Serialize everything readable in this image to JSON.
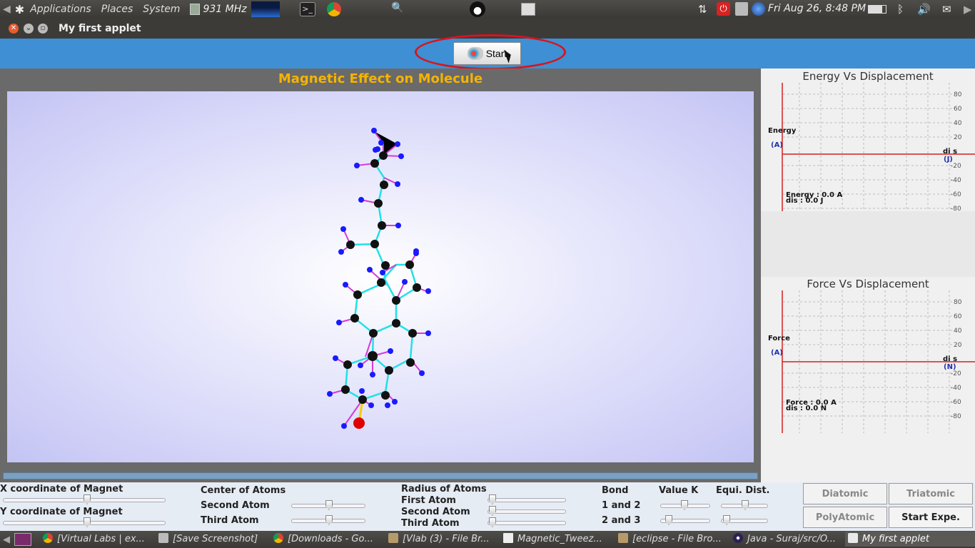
{
  "top_panel": {
    "menus": [
      "Applications",
      "Places",
      "System"
    ],
    "cpu_freq": "931 MHz",
    "clock": "Fri Aug 26,  8:48 PM"
  },
  "window": {
    "title": "My first applet"
  },
  "toolbar": {
    "start_label": "Start"
  },
  "sim": {
    "title": "Magnetic Effect on Molecule"
  },
  "graphs": {
    "energy": {
      "title": "Energy Vs Displacement",
      "y_label": "Energy",
      "y_unit": "(A)",
      "x_label": "di s",
      "x_unit": "(J)",
      "readout_1": "Energy : 0.0 A",
      "readout_2": "dis : 0.0 J",
      "ticks": [
        "80",
        "60",
        "40",
        "20",
        "-20",
        "-40",
        "-60",
        "-80"
      ]
    },
    "force": {
      "title": "Force Vs Displacement",
      "y_label": "Force",
      "y_unit": "(A)",
      "x_label": "di s",
      "x_unit": "(N)",
      "readout_1": "Force : 0.0 A",
      "readout_2": "dis : 0.0 N",
      "ticks": [
        "80",
        "60",
        "40",
        "20",
        "-20",
        "-40",
        "-60",
        "-80"
      ]
    }
  },
  "controls": {
    "x_magnet": "X coordinate of Magnet",
    "y_magnet": "Y coordinate of Magnet",
    "center_atoms": "Center of Atoms",
    "second_atom": "Second Atom",
    "third_atom": "Third Atom",
    "radius_atoms": "Radius of Atoms",
    "r_first": "First Atom",
    "r_second": "Second Atom",
    "r_third": "Third Atom",
    "bond": "Bond",
    "value_k": "Value K",
    "equi_dist": "Equi. Dist.",
    "bond_12": "1 and 2",
    "bond_23": "2 and 3"
  },
  "modes": {
    "diatomic": "Diatomic",
    "triatomic": "Triatomic",
    "polyatomic": "PolyAtomic",
    "start_expe": "Start Expe."
  },
  "taskbar": {
    "tasks": [
      "[Virtual Labs | ex...",
      "[Save Screenshot]",
      "[Downloads - Go...",
      "[Vlab (3) - File Br...",
      "Magnetic_Tweez...",
      "[eclipse - File Bro...",
      "Java - Suraj/src/O...",
      "My first applet"
    ]
  }
}
